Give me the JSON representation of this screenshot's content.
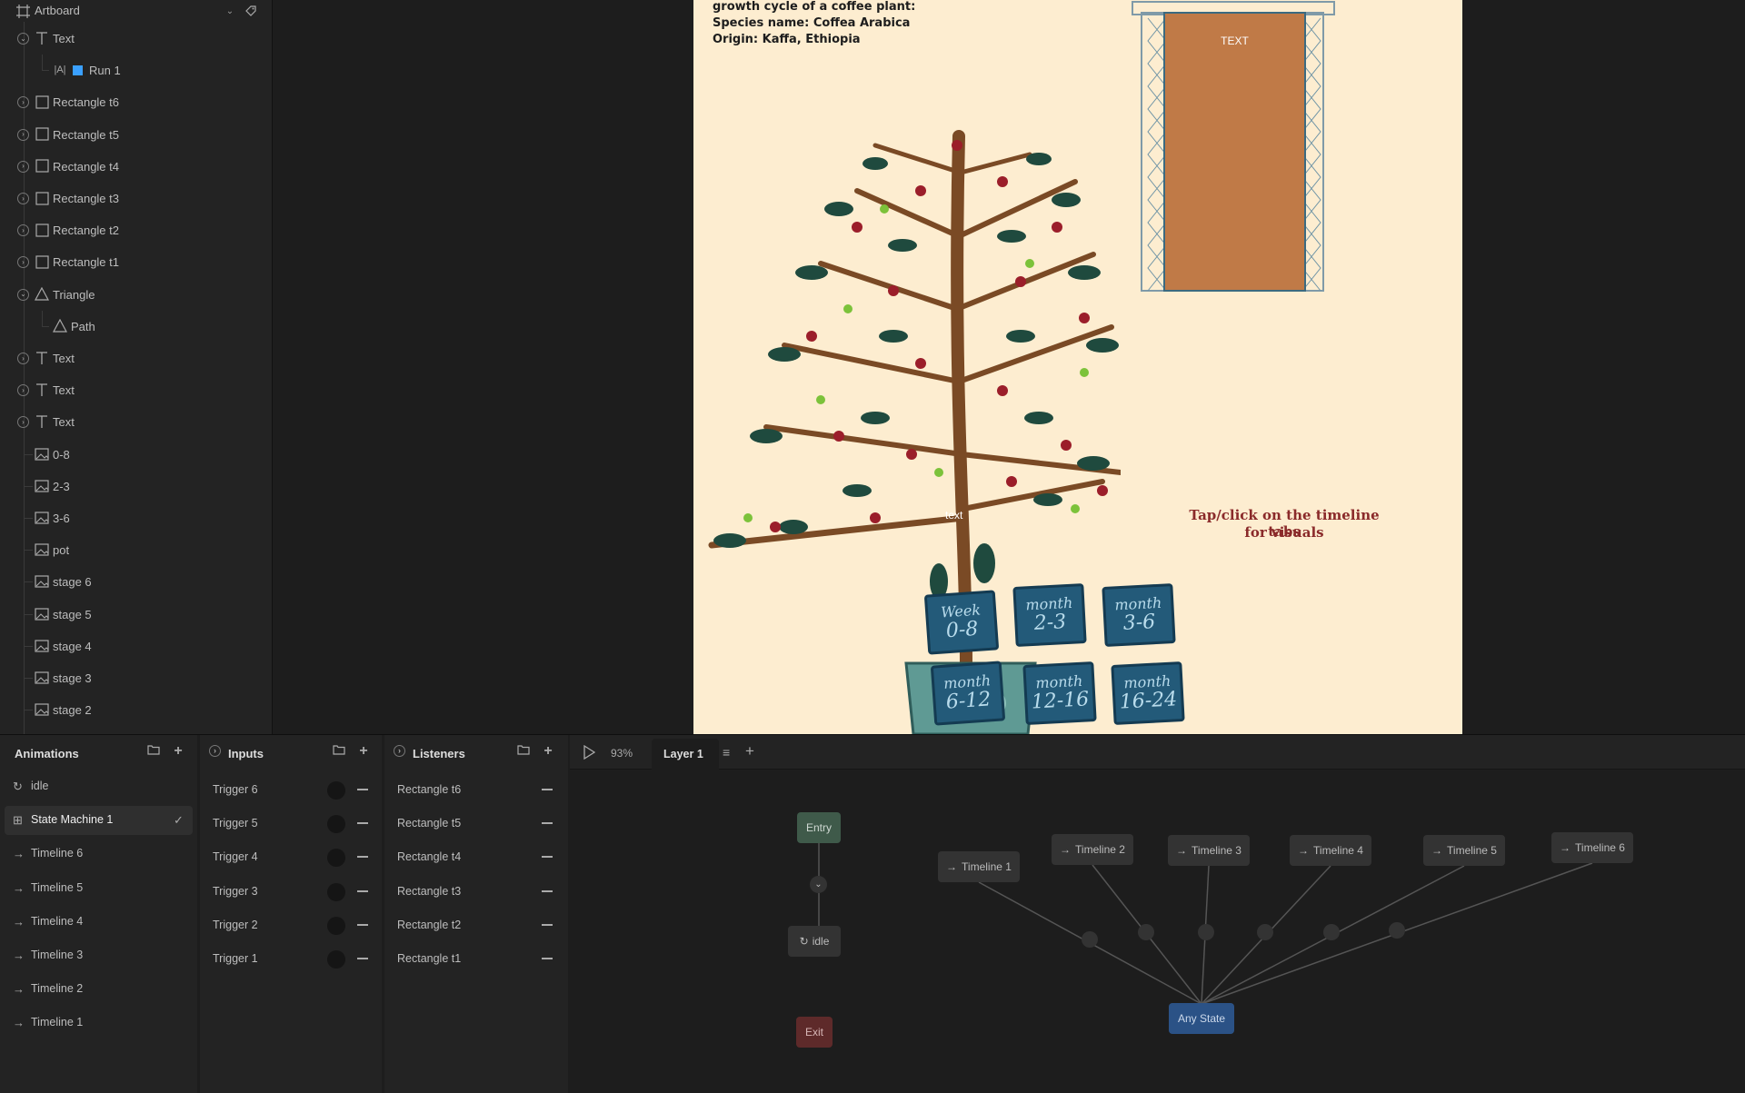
{
  "hierarchy": {
    "artboard_label": "Artboard",
    "items": [
      {
        "label": "Text"
      },
      {
        "label": "Run 1"
      },
      {
        "label": "Rectangle t6"
      },
      {
        "label": "Rectangle t5"
      },
      {
        "label": "Rectangle t4"
      },
      {
        "label": "Rectangle t3"
      },
      {
        "label": "Rectangle t2"
      },
      {
        "label": "Rectangle t1"
      },
      {
        "label": "Triangle"
      },
      {
        "label": "Path"
      },
      {
        "label": "Text"
      },
      {
        "label": "Text"
      },
      {
        "label": "Text"
      },
      {
        "label": "0-8"
      },
      {
        "label": "2-3"
      },
      {
        "label": "3-6"
      },
      {
        "label": "pot"
      },
      {
        "label": "stage 6"
      },
      {
        "label": "stage 5"
      },
      {
        "label": "stage 4"
      },
      {
        "label": "stage 3"
      },
      {
        "label": "stage 2"
      }
    ]
  },
  "artboard": {
    "info_line1": "growth cycle of a coffee plant:",
    "info_line2": "Species name: Coffea Arabica",
    "info_line3": "Origin: Kaffa, Ethiopia",
    "text_box_label": "TEXT",
    "tree_text": "text",
    "tap_line1": "Tap/click on the timeline tabs",
    "tap_line2": "for visuals",
    "tabs": [
      {
        "top": "Week",
        "bottom": "0-8"
      },
      {
        "top": "month",
        "bottom": "2-3"
      },
      {
        "top": "month",
        "bottom": "3-6"
      },
      {
        "top": "month",
        "bottom": "6-12"
      },
      {
        "top": "month",
        "bottom": "12-16"
      },
      {
        "top": "month",
        "bottom": "16-24"
      }
    ],
    "colors": {
      "background": "#fdedd0",
      "text_box": "#c07a47",
      "tab": "#235a79",
      "pot": "#5f9a94"
    }
  },
  "animations": {
    "title": "Animations",
    "items": [
      "idle",
      "State Machine 1",
      "Timeline 6",
      "Timeline 5",
      "Timeline 4",
      "Timeline 3",
      "Timeline 2",
      "Timeline 1"
    ],
    "selected": "State Machine 1"
  },
  "inputs": {
    "title": "Inputs",
    "items": [
      "Trigger 6",
      "Trigger 5",
      "Trigger 4",
      "Trigger 3",
      "Trigger 2",
      "Trigger 1"
    ]
  },
  "listeners": {
    "title": "Listeners",
    "items": [
      "Rectangle t6",
      "Rectangle t5",
      "Rectangle t4",
      "Rectangle t3",
      "Rectangle t2",
      "Rectangle t1"
    ]
  },
  "state_machine": {
    "zoom": "93%",
    "layer_tab": "Layer 1",
    "nodes": {
      "entry": "Entry",
      "idle": "idle",
      "exit": "Exit",
      "any_state": "Any State",
      "timelines": [
        "Timeline 1",
        "Timeline 2",
        "Timeline 3",
        "Timeline 4",
        "Timeline 5",
        "Timeline 6"
      ]
    },
    "colors": {
      "entry": "#3f5a4a",
      "exit": "#5e2a2a",
      "any_state": "#2b5286",
      "accent": "#3aa0ff"
    }
  }
}
